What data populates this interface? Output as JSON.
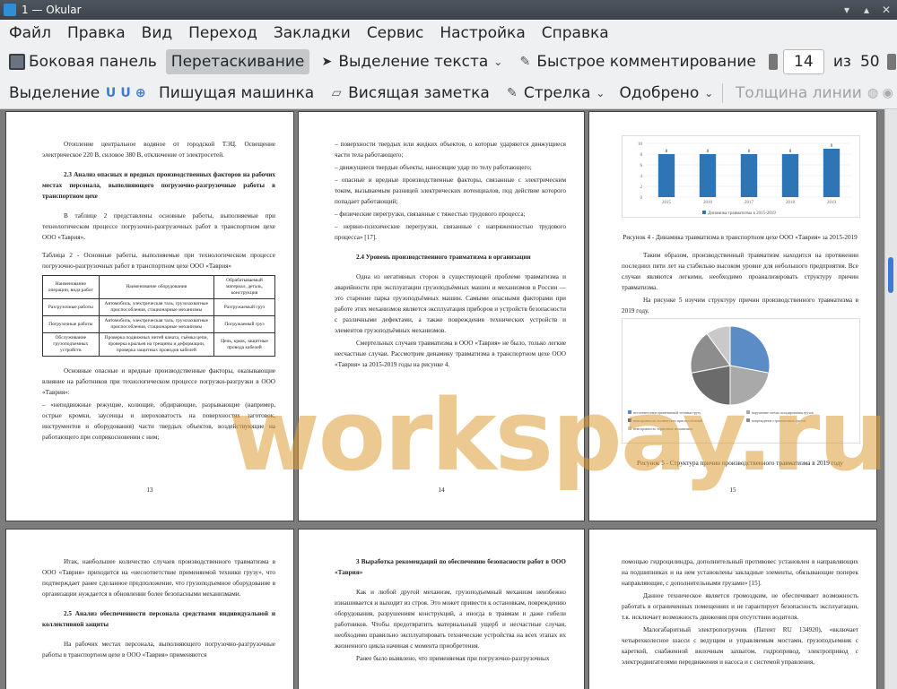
{
  "window": {
    "title": "1 — Okular"
  },
  "menu": [
    "Файл",
    "Правка",
    "Вид",
    "Переход",
    "Закладки",
    "Сервис",
    "Настройка",
    "Справка"
  ],
  "toolbar1": {
    "sidebar": "Боковая панель",
    "browse": "Перетаскивание",
    "text_select": "Выделение текста",
    "quick_annot": "Быстрое комментирование",
    "page_current": "14",
    "page_of": "из",
    "page_total": "50"
  },
  "toolbar2": {
    "highlight": "Выделение",
    "typewriter": "Пишущая машинка",
    "note": "Висящая заметка",
    "arrow": "Стрелка",
    "stamp": "Одобрено",
    "line_width": "Толщина линии"
  },
  "watermark": "workspay.ru",
  "pages": {
    "p1": {
      "p_intro": "Отопление центральное водяное от городской ТЭЦ. Освещение электрическое 220 В, силовое 380 В, отключение от электросетей.",
      "heading": "2.3 Анализ опасных и вредных производственных факторов на рабочих местах персонала, выполняющего погрузочно-разгрузочные работы в транспортном цехе",
      "p2": "В таблице 2 представлены основные работы, выполняемые при технологическом процессе погрузочно-разгрузочных работ в транспортном цехе ООО «Таврия».",
      "table_caption": "Таблица 2 - Основные работы, выполняемые при технологическом процессе погрузочно-разгрузочных работ в транспортном цехе ООО «Таврия»",
      "table_head": [
        "Наименование операции, вида работ",
        "Наименование оборудования",
        "Обрабатываемый материал, деталь, конструкция"
      ],
      "table_rows": [
        [
          "Разгрузочные работы",
          "Автомобиль, электрическая таль, грузозахватные приспособления, стационарные механизмы",
          "Разгружаемый груз"
        ],
        [
          "Погрузочные работы",
          "Автомобиль, электрическая таль, грузозахватные приспособления, стационарные механизмы",
          "Погружаемый груз"
        ],
        [
          "Обслуживание грузоподъемных устройств",
          "Проверка подвижных нитей каната, съёмка цепи, проверка крыльев на трещины и деформации, проверка защитных проводов кабелей",
          "Цепь, крюк, защитные провода кабелей"
        ]
      ],
      "p3": "Основные опасные и вредные производственные факторы, оказывающие влияние на работников при технологическом процессе погрузки-разгрузки в ООО «Таврия»:",
      "p4": "– «неподвижные режущие, колющие, обдирающие, разрывающие (например, острые кромки, заусенцы и шероховатость на поверхностях заготовок, инструментов и оборудования) части твердых объектов, воздействующие на работающего при соприкосновении с ним;",
      "num": "13"
    },
    "p2": {
      "items": [
        "– поверхности твердых или жидких объектов, о которые ударяются движущиеся части тела работающего;",
        "– движущиеся твердые объекты, наносящие удар по телу работающего;",
        "– опасные и вредные производственные факторы, связанные с электрическим током, вызываемым разницей электрических потенциалов, под действие которого попадает работающий;",
        "– физические перегрузки, связанные с тяжестью трудового процесса;",
        "– нервно-психические перегрузки, связанные с напряженностью трудового процесса» [17]."
      ],
      "heading": "2.4 Уровень производственного травматизма в организации",
      "p1": "Одна из негативных сторон в существующей проблеме травматизма и аварийности при эксплуатации грузоподъёмных машин и механизмов в России — это старение парка грузоподъёмных машин. Самыми опасными факторами при работе этих механизмов является эксплуатация приборов и устройств безопасности с различными дефектами, а также повреждения технических устройств и элементов грузоподъёмных механизмов.",
      "p2": "Смертельных случаев травматизма в ООО «Таврия» не было, только легкие несчастные случаи. Рассмотрим динамику травматизма в транспортном цехе ООО «Таврия» за 2015-2019 годы на рисунке 4.",
      "num": "14"
    },
    "p3": {
      "fig4_caption": "Рисунок 4 - Динамика травматизма в транспортном цехе ООО «Таврия» за 2015-2019",
      "p1": "Таким образом, производственный травматизм находится на протяжении последних пяти лет на стабильно высоком уровне для небольшого предприятия. Все случаи являются легкими, необходимо проанализировать структуру причин травматизма.",
      "p2": "На рисунке 5 изучим структуру причин производственного травматизма в 2019 году.",
      "fig5_caption": "Рисунок 5 - Структура причин производственного травматизма в 2019 году",
      "num": "15"
    },
    "p4": {
      "p1": "Итак, наибольшее количество случаев производственного травматизма в ООО «Таврия» приходится на «несоответствие применяемой техники грузу», что подтверждает ранее сделанное предположение, что грузоподъемное оборудование в организации нуждается в обновлении более безопасными механизмами.",
      "heading": "2.5 Анализ обеспеченности персонала средствами индивидуальной и коллективной защиты",
      "p2": "На рабочих местах персонала, выполняющего погрузочно-разгрузочные работы в транспортном цехе в ООО «Таврия» применяются"
    },
    "p5": {
      "heading": "3 Выработка рекомендаций по обеспечению безопасности работ в ООО «Таврия»",
      "p1": "Как и любой другой механизм, грузоподъемный механизм неизбежно изнашивается и выходит из строя. Это может привести к остановкам, повреждению оборудования, разрушениям конструкций, а иногда в травмам и даже гибели работников. Чтобы предотвратить материальный ущерб и несчастные случаи, необходимо правильно эксплуатировать технические устройства на всех этапах их жизненного цикла начиная с момента приобретения.",
      "p2": "Ранее было выявлено, что применяемая при погрузочно-разгрузочных"
    },
    "p6": {
      "p1": "помощью гидроцилиндра, дополнительный противовес установлен в направляющих на подшипниках и на нем установлены закладные элементы, обязывающие поперек направляющие, с дополнительными грузами» [15].",
      "p2": "Данное техническое является громоздким, не обеспечивает возможность работать в ограниченных помещениях и не гарантирует безопасность эксплуатации, т.к. исключает возможность движения при отсутствии водителя.",
      "p3": "Малогабаритный электропогрузчик (Патент RU 134920), «включает четырехколесное шасси с ведущим и управляемым мостами, грузоподъемник с кареткой, снабженной вилочным захватом, гидропривод, электропривод с электродвигателями передвижения и насоса и с системой управления,"
    }
  },
  "chart_data": [
    {
      "type": "bar",
      "categories": [
        "2015",
        "2016",
        "2017",
        "2018",
        "2019"
      ],
      "values": [
        8,
        8,
        8,
        8,
        9
      ],
      "ylim": [
        0,
        10
      ],
      "yticks": [
        "0",
        "2",
        "4",
        "6",
        "8",
        "10"
      ],
      "legend": "Динамика травматизма в 2015-2019",
      "color": "#2e75b6"
    },
    {
      "type": "pie",
      "values": [
        28,
        22,
        22,
        18,
        10
      ],
      "colors": [
        "#5b8cc6",
        "#a9a9a9",
        "#6b6b6b",
        "#8d8d8d",
        "#c9c9c9"
      ],
      "legend": [
        "несоответствие применяемой техники грузу",
        "нарушение схемы складирования грузов",
        "неисправность технических приспособлений",
        "повреждение строповочных тросов",
        "неисправность тормозных механизмов"
      ]
    }
  ]
}
